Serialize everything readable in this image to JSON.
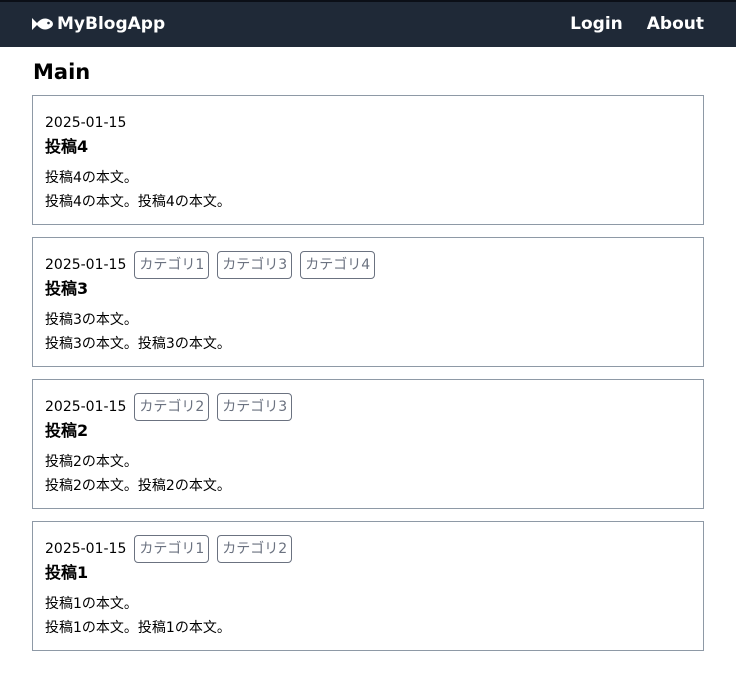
{
  "navbar": {
    "brand": "MyBlogApp",
    "brand_icon": "fish-icon",
    "links": [
      "Login",
      "About"
    ]
  },
  "page": {
    "title": "Main"
  },
  "posts": [
    {
      "date": "2025-01-15",
      "categories": [],
      "title": "投稿4",
      "body": [
        "投稿4の本文。",
        "投稿4の本文。投稿4の本文。"
      ]
    },
    {
      "date": "2025-01-15",
      "categories": [
        "カテゴリ1",
        "カテゴリ3",
        "カテゴリ4"
      ],
      "title": "投稿3",
      "body": [
        "投稿3の本文。",
        "投稿3の本文。投稿3の本文。"
      ]
    },
    {
      "date": "2025-01-15",
      "categories": [
        "カテゴリ2",
        "カテゴリ3"
      ],
      "title": "投稿2",
      "body": [
        "投稿2の本文。",
        "投稿2の本文。投稿2の本文。"
      ]
    },
    {
      "date": "2025-01-15",
      "categories": [
        "カテゴリ1",
        "カテゴリ2"
      ],
      "title": "投稿1",
      "body": [
        "投稿1の本文。",
        "投稿1の本文。投稿1の本文。"
      ]
    }
  ],
  "colors": {
    "navbar_bg": "#1f2937",
    "category_border": "#6b7280",
    "card_border": "#8e99a6"
  }
}
